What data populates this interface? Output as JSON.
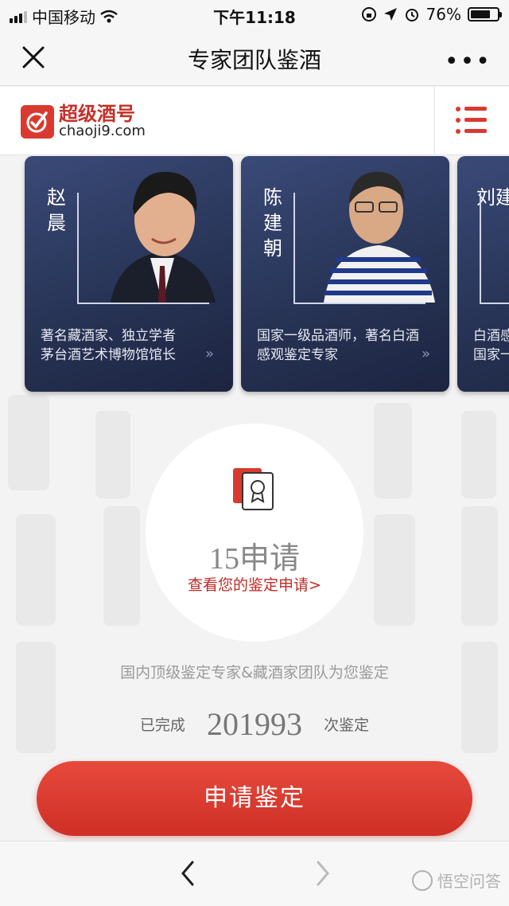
{
  "status_bar": {
    "carrier": "中国移动",
    "time": "下午11:18",
    "battery": "76%",
    "battery_level": 0.76
  },
  "nav": {
    "title": "专家团队鉴酒",
    "more": "•••"
  },
  "brand": {
    "name_cn": "超级酒号",
    "name_en": "chaoji9.com"
  },
  "experts": [
    {
      "name": "赵晨",
      "desc_line1": "著名藏酒家、独立学者",
      "desc_line2": "茅台酒艺术博物馆馆长"
    },
    {
      "name": "陈建朝",
      "desc_line1": "国家一级品酒师，著名白酒",
      "desc_line2": "感观鉴定专家"
    },
    {
      "name": "刘建",
      "desc_line1": "白酒感",
      "desc_line2": "国家一"
    }
  ],
  "application": {
    "count_text": "15申请",
    "view_link": "查看您的鉴定申请>"
  },
  "tagline": "国内顶级鉴定专家&藏酒家团队为您鉴定",
  "stats": {
    "prefix": "已完成",
    "count": "201993",
    "suffix": "次鉴定"
  },
  "apply_button": "申请鉴定",
  "watermark": "悟空问答",
  "colors": {
    "brand_red": "#d93a2f",
    "card_navy": "#283456",
    "button_red": "#d8392e"
  }
}
